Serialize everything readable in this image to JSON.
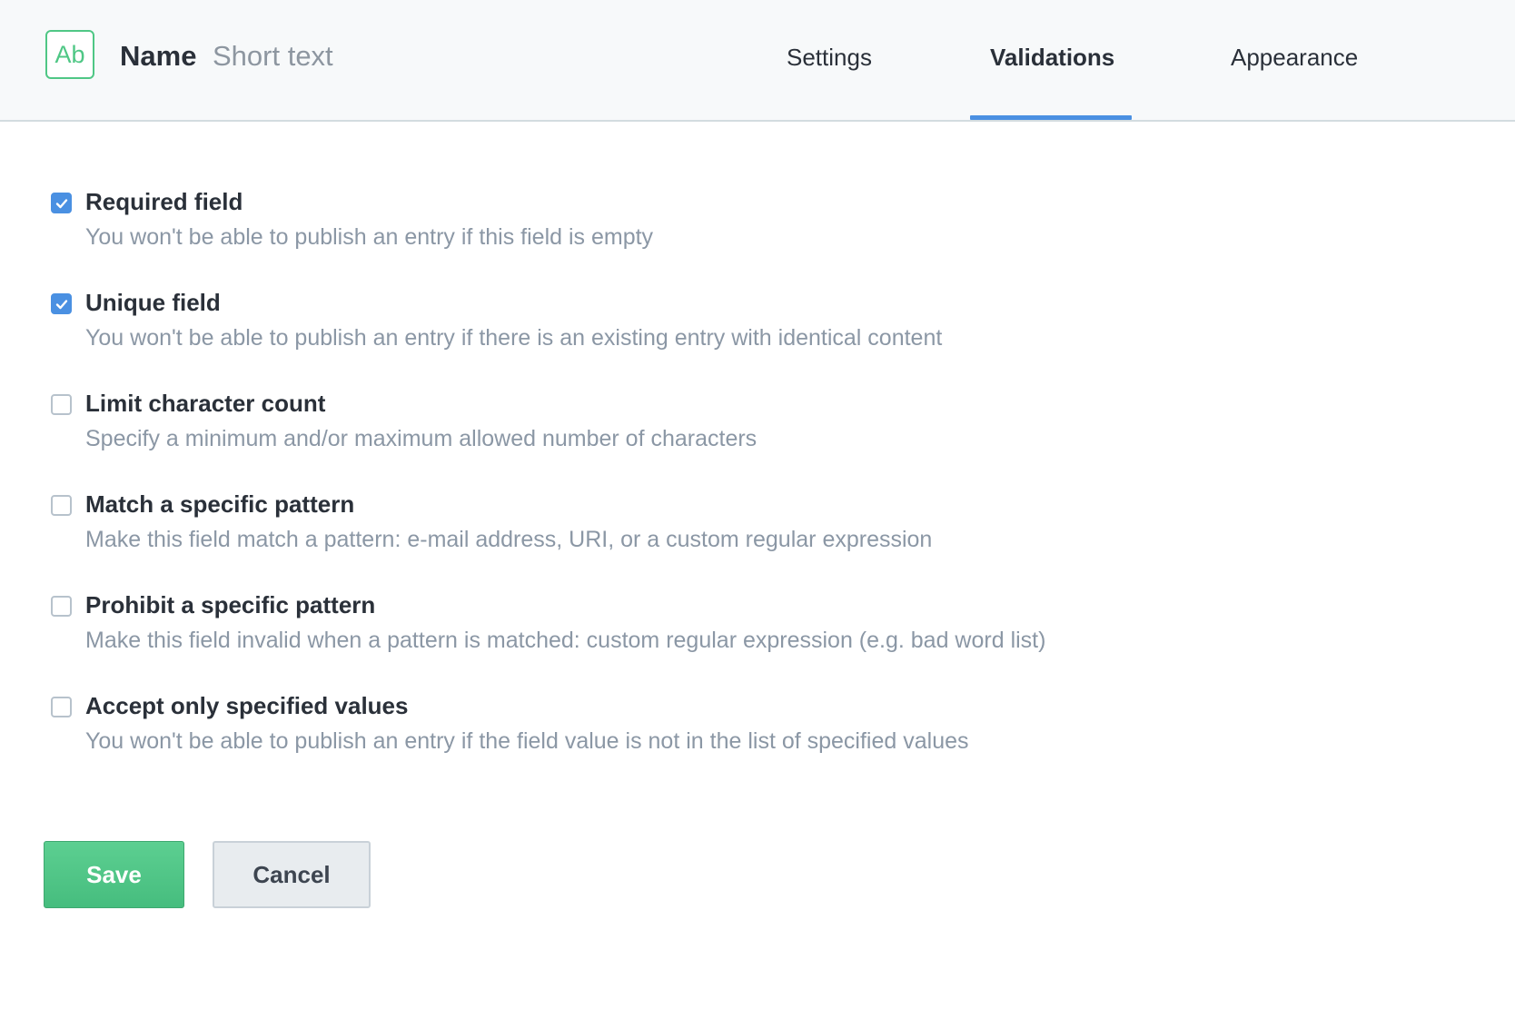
{
  "header": {
    "icon_text": "Ab",
    "field_name": "Name",
    "field_type": "Short text",
    "tabs": [
      {
        "label": "Settings",
        "active": false
      },
      {
        "label": "Validations",
        "active": true
      },
      {
        "label": "Appearance",
        "active": false
      }
    ]
  },
  "colors": {
    "accent": "#4a90e2",
    "success": "#4fc785",
    "muted_text": "#8b97a5"
  },
  "validations": [
    {
      "title": "Required field",
      "description": "You won't be able to publish an entry if this field is empty",
      "checked": true
    },
    {
      "title": "Unique field",
      "description": "You won't be able to publish an entry if there is an existing entry with identical content",
      "checked": true
    },
    {
      "title": "Limit character count",
      "description": "Specify a minimum and/or maximum allowed number of characters",
      "checked": false
    },
    {
      "title": "Match a specific pattern",
      "description": "Make this field match a pattern: e-mail address, URI, or a custom regular expression",
      "checked": false
    },
    {
      "title": "Prohibit a specific pattern",
      "description": "Make this field invalid when a pattern is matched: custom regular expression (e.g. bad word list)",
      "checked": false
    },
    {
      "title": "Accept only specified values",
      "description": "You won't be able to publish an entry if the field value is not in the list of specified values",
      "checked": false
    }
  ],
  "actions": {
    "save_label": "Save",
    "cancel_label": "Cancel"
  }
}
